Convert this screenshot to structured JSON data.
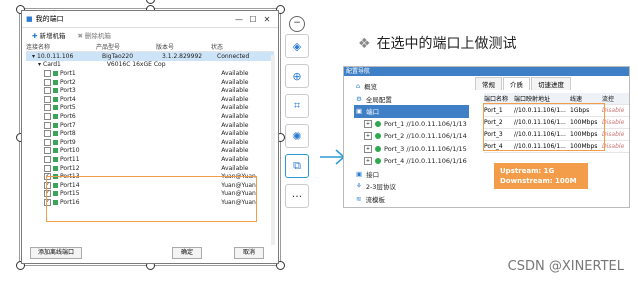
{
  "dialog": {
    "title": "我的端口",
    "toolbar": {
      "new_chassis": "新增机箱",
      "delete_chassis": "删除机箱"
    },
    "columns": [
      "连接名称",
      "产品型号",
      "版本号",
      "状态"
    ],
    "rows": [
      {
        "name": "10.0.11.106",
        "model": "BigTao220",
        "version": "3.1.2.829992",
        "status": "Connected",
        "selected": true,
        "indent": 1
      },
      {
        "name": "Card1",
        "model": "V6016C 16xGE Cop...",
        "version": "",
        "status": "",
        "indent": 2
      },
      {
        "name": "Port1",
        "status": "Available",
        "indent": 3
      },
      {
        "name": "Port2",
        "status": "Available",
        "indent": 3
      },
      {
        "name": "Port3",
        "status": "Available",
        "indent": 3
      },
      {
        "name": "Port4",
        "status": "Available",
        "indent": 3
      },
      {
        "name": "Port5",
        "status": "Available",
        "indent": 3
      },
      {
        "name": "Port6",
        "status": "Available",
        "indent": 3
      },
      {
        "name": "Port7",
        "status": "Available",
        "indent": 3
      },
      {
        "name": "Port8",
        "status": "Available",
        "indent": 3
      },
      {
        "name": "Port9",
        "status": "Available",
        "indent": 3
      },
      {
        "name": "Port10",
        "status": "Available",
        "indent": 3
      },
      {
        "name": "Port11",
        "status": "Available",
        "indent": 3
      },
      {
        "name": "Port12",
        "status": "Available",
        "indent": 3
      },
      {
        "name": "Port13",
        "status": "Yuan@Yuan",
        "checked": true,
        "indent": 3
      },
      {
        "name": "Port14",
        "status": "Yuan@Yuan",
        "checked": true,
        "indent": 3
      },
      {
        "name": "Port15",
        "status": "Yuan@Yuan",
        "checked": true,
        "indent": 3
      },
      {
        "name": "Port16",
        "status": "Yuan@Yuan",
        "checked": true,
        "indent": 3
      }
    ],
    "footer": {
      "add_port": "添加离线端口",
      "ok": "确定",
      "cancel": "取消"
    }
  },
  "side_toolbar": {
    "minus": "−",
    "more": "···"
  },
  "slide": {
    "bullet_text": "在选中的端口上做测试"
  },
  "right_panel": {
    "caption": "配置导航",
    "tree": [
      {
        "label": "概览",
        "icon": "home"
      },
      {
        "label": "全局配置",
        "icon": "gear"
      },
      {
        "label": "端口",
        "icon": "box",
        "selected": true
      },
      {
        "label": "Port_1 //10.0.11.106/1/13",
        "icon": "dot"
      },
      {
        "label": "Port_2 //10.0.11.106/1/14",
        "icon": "dot"
      },
      {
        "label": "Port_3 //10.0.11.106/1/15",
        "icon": "dot"
      },
      {
        "label": "Port_4 //10.0.11.106/1/16",
        "icon": "dot"
      },
      {
        "label": "接口",
        "icon": "box"
      },
      {
        "label": "2-3层协议",
        "icon": "net"
      },
      {
        "label": "流模板",
        "icon": "flow"
      }
    ],
    "tabs": [
      "常规",
      "介质",
      "切速进度"
    ],
    "table_head": [
      "端口名称",
      "端口映射地址",
      "线速",
      "流控"
    ],
    "table_rows": [
      [
        "Port_1",
        "//10.0.11.106/1...",
        "1Gbps",
        "Disable"
      ],
      [
        "Port_2",
        "//10.0.11.106/1...",
        "100Mbps",
        "Disable"
      ],
      [
        "Port_3",
        "//10.0.11.106/1...",
        "100Mbps",
        "Disable"
      ],
      [
        "Port_4",
        "//10.0.11.106/1...",
        "100Mbps",
        "Disable"
      ]
    ],
    "note_upstream": "Upstream: 1G",
    "note_downstream": "Downstream: 100M"
  },
  "watermark": "CSDN @XINERTEL"
}
